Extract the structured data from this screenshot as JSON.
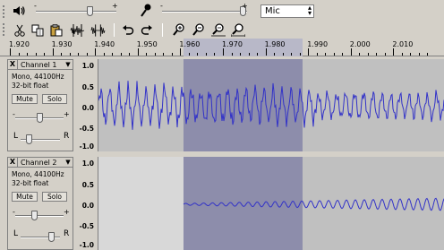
{
  "toolbar": {
    "volume_icon": "speaker-icon",
    "output_slider": {
      "minus": "-",
      "plus": "+",
      "value": 0.75
    },
    "mic_icon": "microphone-icon",
    "input_slider": {
      "minus": "-",
      "plus": "+",
      "value": 1.0
    },
    "input_source": "Mic",
    "edit_tools": [
      "cut-icon",
      "copy-icon",
      "paste-icon",
      "trim-icon",
      "silence-icon",
      "undo-icon",
      "redo-icon",
      "zoom-in-icon",
      "zoom-out-icon",
      "fit-selection-icon",
      "fit-project-icon"
    ]
  },
  "ruler": {
    "labels": [
      "1.920",
      "1.930",
      "1.940",
      "1.950",
      "1.960",
      "1.970",
      "1.980",
      "1.990",
      "2.000",
      "2.010"
    ]
  },
  "tracks": [
    {
      "name": "Channel 1",
      "close": "X",
      "menu": "▼",
      "info1": "Mono, 44100Hz",
      "info2": "32-bit float",
      "mute": "Mute",
      "solo": "Solo",
      "pan_left": "L",
      "pan_right": "R",
      "gain_minus": "-",
      "gain_plus": "+",
      "gain_value": 0.5,
      "pan_value": 0.3,
      "scale": [
        "1.0",
        "0.5",
        "0.0",
        "-0.5",
        "-1.0"
      ]
    },
    {
      "name": "Channel 2",
      "close": "X",
      "menu": "▼",
      "info1": "Mono, 44100Hz",
      "info2": "32-bit float",
      "mute": "Mute",
      "solo": "Solo",
      "pan_left": "L",
      "pan_right": "R",
      "gain_minus": "-",
      "gain_plus": "+",
      "gain_value": 0.5,
      "pan_value": 0.7,
      "scale": [
        "1.0",
        "0.5",
        "0.0",
        "-0.5",
        "-1.0"
      ]
    }
  ],
  "colors": {
    "waveform": "#3232c8",
    "selection": "#8d8dab",
    "track_bg": "#c0c0c0",
    "track2_bg_left": "#d8d8d8",
    "ui": "#d4d0c8"
  }
}
